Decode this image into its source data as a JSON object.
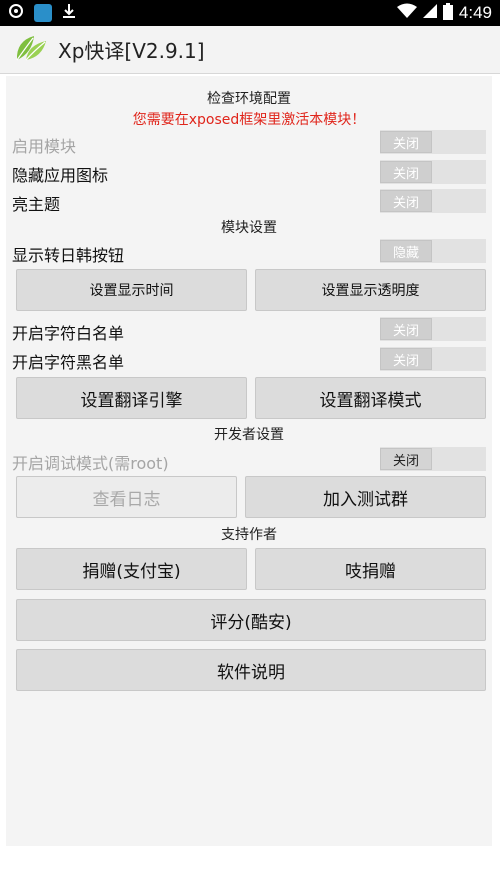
{
  "status_bar": {
    "time": "4:49",
    "icons": [
      "settings-ring-icon",
      "app-notification-icon",
      "download-icon",
      "wifi-icon",
      "signal-icon",
      "battery-icon"
    ]
  },
  "app": {
    "title": "Xp快译[V2.9.1]",
    "logo": "leaf-logo-icon"
  },
  "sections": {
    "env": "检查环境配置",
    "module": "模块设置",
    "dev": "开发者设置",
    "support": "支持作者"
  },
  "warning": "您需要在xposed框架里激活本模块！",
  "rows": {
    "enable_module": {
      "label": "启用模块",
      "toggle": "关闭"
    },
    "hide_icon": {
      "label": "隐藏应用图标",
      "toggle": "关闭"
    },
    "light_theme": {
      "label": "亮主题",
      "toggle": "关闭"
    },
    "show_jk_button": {
      "label": "显示转日韩按钮",
      "toggle": "隐藏"
    },
    "whitelist": {
      "label": "开启字符白名单",
      "toggle": "关闭"
    },
    "blacklist": {
      "label": "开启字符黑名单",
      "toggle": "关闭"
    },
    "debug_mode": {
      "label": "开启调试模式(需root)",
      "toggle": "关闭"
    }
  },
  "buttons": {
    "display_time": "设置显示时间",
    "display_opacity": "设置显示透明度",
    "engine": "设置翻译引擎",
    "mode": "设置翻译模式",
    "view_log": "查看日志",
    "join_test": "加入测试群",
    "donate_alipay": "捐赠(支付宝)",
    "donate_other": "吱捐赠",
    "rate": "评分(酷安)",
    "manual": "软件说明"
  },
  "colors": {
    "warning": "#e0251b",
    "status_bar": "#000000",
    "button": "#dcdcdc"
  }
}
